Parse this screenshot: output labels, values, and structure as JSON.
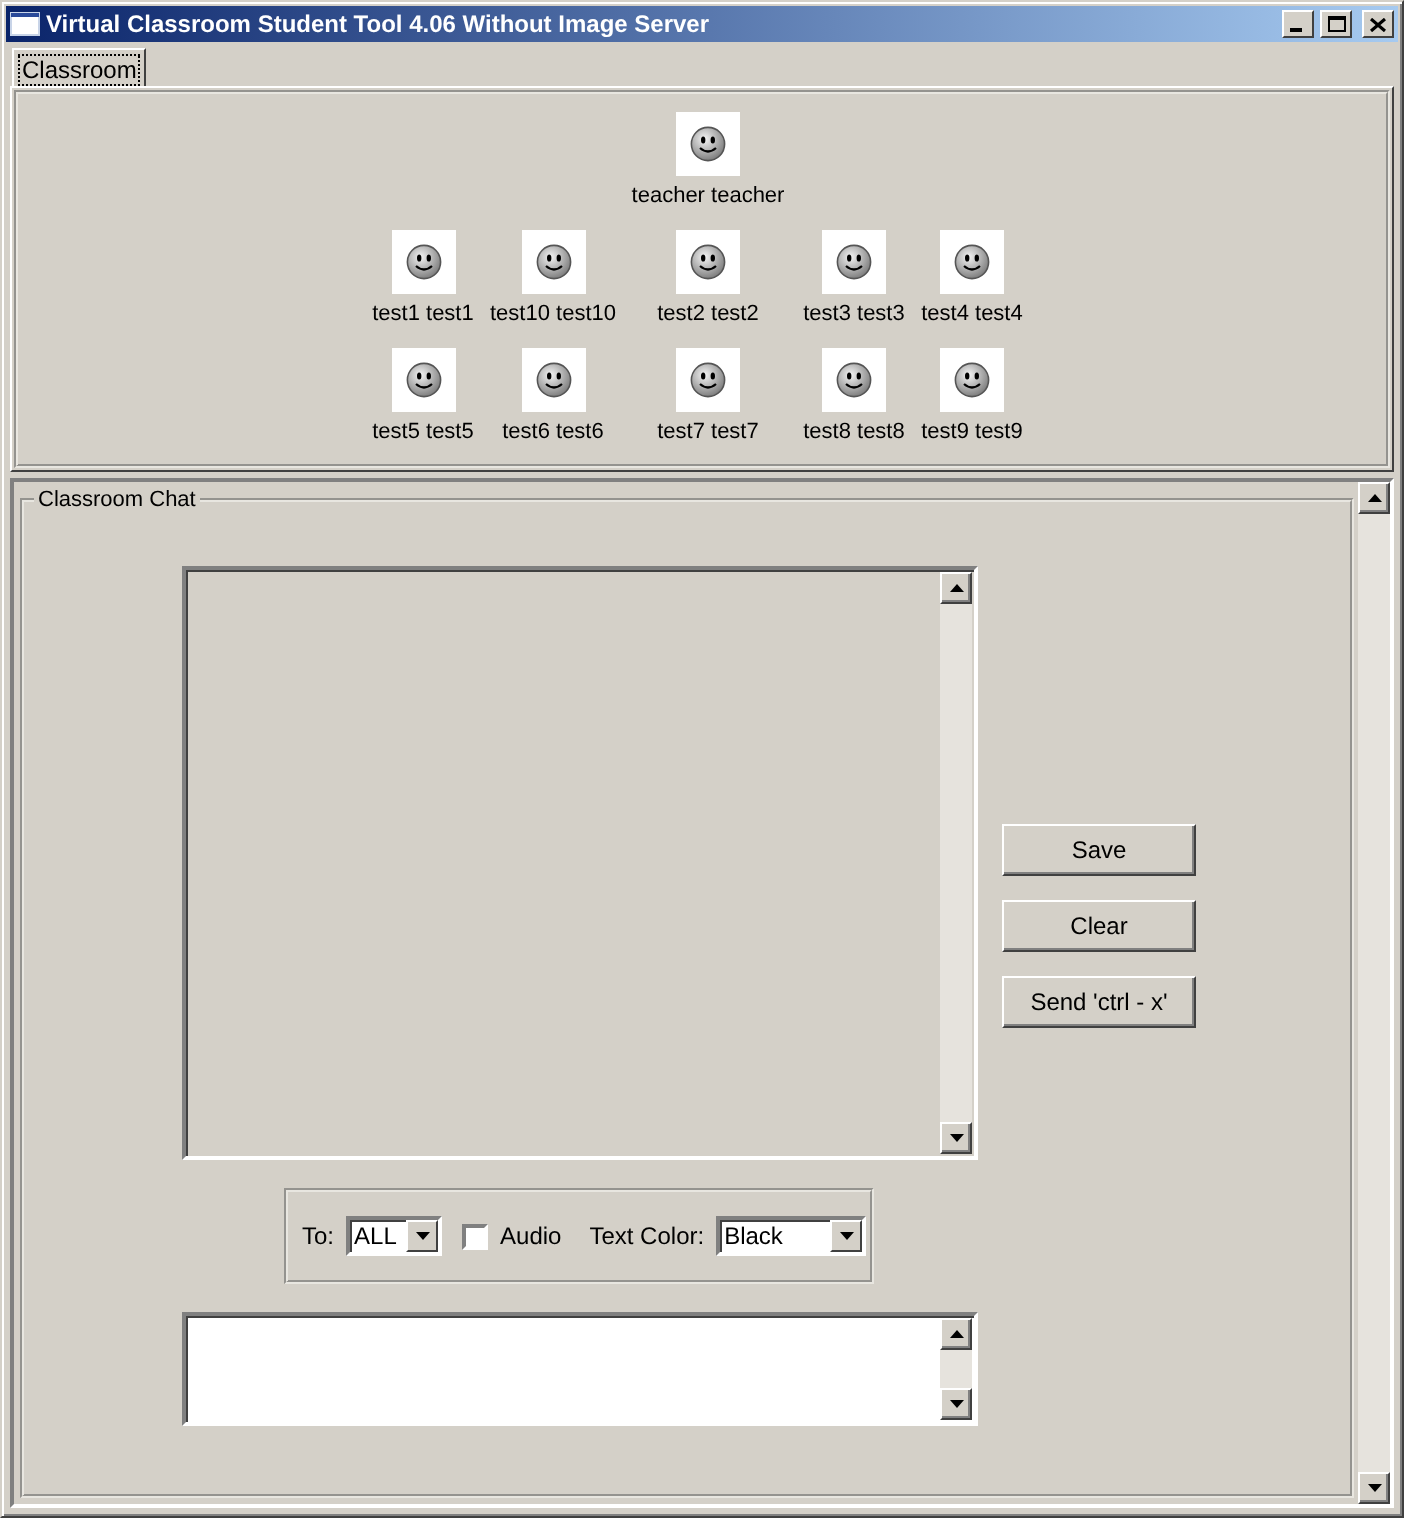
{
  "window": {
    "title": "Virtual Classroom Student Tool 4.06 Without Image Server"
  },
  "tabs": [
    {
      "label": "Classroom",
      "selected": true
    }
  ],
  "classroom": {
    "teacher": {
      "name": "teacher teacher"
    },
    "students": [
      [
        "test1 test1",
        "test10 test10",
        "test2 test2",
        "test3 test3",
        "test4 test4"
      ],
      [
        "test5 test5",
        "test6 test6",
        "test7 test7",
        "test8 test8",
        "test9 test9"
      ]
    ]
  },
  "chat": {
    "title": "Classroom Chat",
    "buttons": [
      "Save",
      "Clear",
      "Send 'ctrl - x'"
    ],
    "to": {
      "label": "To:",
      "value": "ALL"
    },
    "audio": {
      "label": "Audio",
      "checked": false
    },
    "text_color": {
      "label": "Text Color:",
      "value": "Black"
    }
  }
}
